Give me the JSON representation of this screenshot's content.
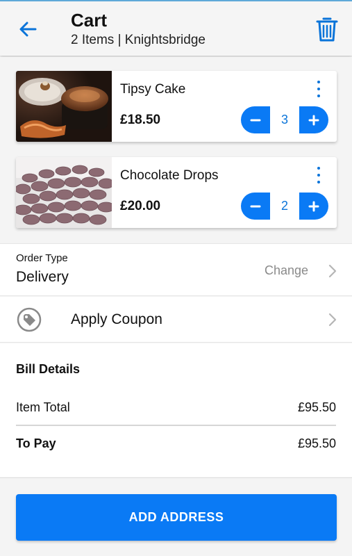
{
  "header": {
    "title": "Cart",
    "subtitle": "2 Items | Knightsbridge",
    "back_icon": "arrow-left-icon",
    "trash_icon": "trash-icon",
    "accent_color": "#0a74d9"
  },
  "cart": {
    "items": [
      {
        "name": "Tipsy Cake",
        "price": "£18.50",
        "quantity": "3",
        "image": "tipsy-cake-photo"
      },
      {
        "name": "Chocolate Drops",
        "price": "£20.00",
        "quantity": "2",
        "image": "chocolate-drops-photo"
      }
    ],
    "stepper_color": "#0a7af5"
  },
  "order_type": {
    "label": "Order Type",
    "value": "Delivery",
    "change_label": "Change"
  },
  "coupon": {
    "label": "Apply Coupon",
    "icon": "coupon-tag-icon"
  },
  "bill": {
    "title": "Bill Details",
    "item_total_label": "Item Total",
    "item_total_value": "£95.50",
    "to_pay_label": "To Pay",
    "to_pay_value": "£95.50"
  },
  "footer": {
    "cta_label": "ADD ADDRESS",
    "cta_color": "#0a7af5"
  }
}
